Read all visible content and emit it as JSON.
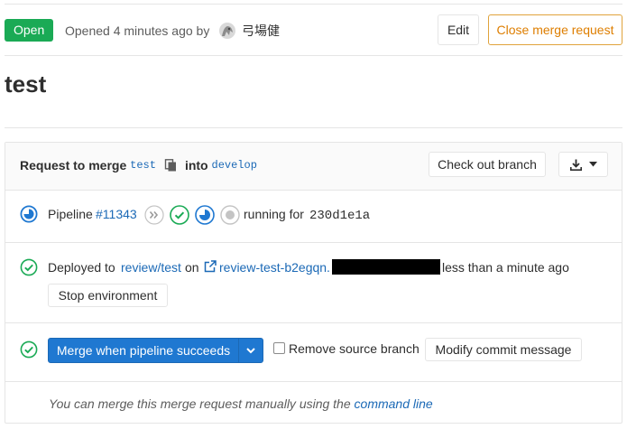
{
  "header": {
    "status_badge": "Open",
    "opened_text": "Opened 4 minutes ago by",
    "author_name": "弓場健",
    "edit_label": "Edit",
    "close_label": "Close merge request"
  },
  "title": "test",
  "merge_request": {
    "request_prefix": "Request to merge",
    "source_branch": "test",
    "into_text": "into",
    "target_branch": "develop",
    "checkout_label": "Check out branch"
  },
  "pipeline": {
    "label": "Pipeline",
    "id": "#11343",
    "stages": [
      "skipped",
      "success",
      "running",
      "created"
    ],
    "running_for": "running for",
    "commit": "230d1e1a",
    "period": "."
  },
  "deployment": {
    "prefix": "Deployed to",
    "environment": "review/test",
    "on_text": "on",
    "url": "review-test-b2egqn.",
    "time": "less than a minute ago",
    "stop_label": "Stop environment"
  },
  "merge": {
    "merge_label": "Merge when pipeline succeeds",
    "remove_source_label": "Remove source branch",
    "modify_label": "Modify commit message"
  },
  "footer": {
    "text": "You can merge this merge request manually using the",
    "link": "command line"
  },
  "colors": {
    "success": "#1aaa55",
    "running": "#1f78d1",
    "warning": "#de7e00",
    "link": "#1b69b6"
  }
}
